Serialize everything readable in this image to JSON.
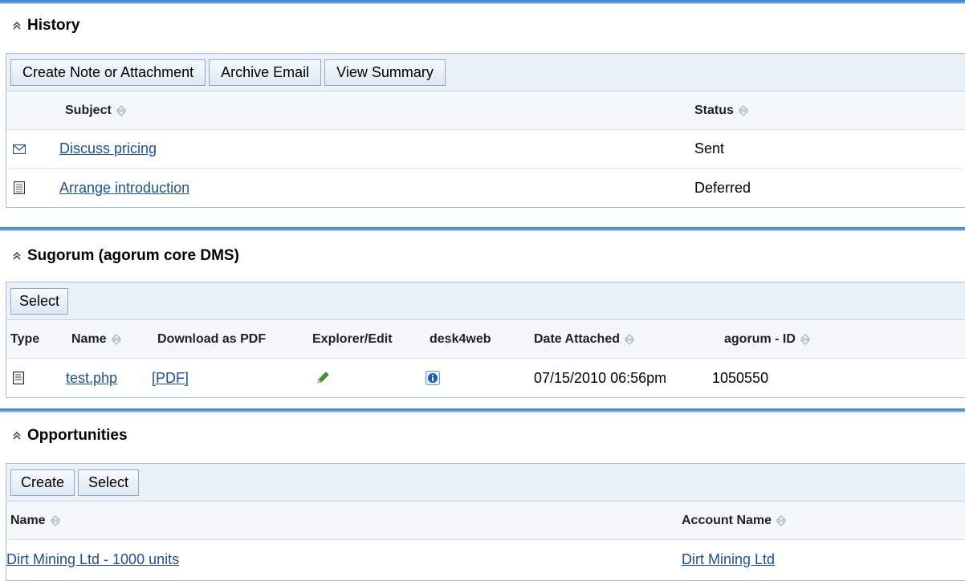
{
  "history": {
    "title": "History",
    "buttons": {
      "create_note": "Create Note or Attachment",
      "archive_email": "Archive Email",
      "view_summary": "View Summary"
    },
    "columns": {
      "subject": "Subject",
      "status": "Status"
    },
    "rows": [
      {
        "icon": "email-icon",
        "subject": "Discuss pricing",
        "status": "Sent"
      },
      {
        "icon": "note-icon",
        "subject": "Arrange introduction",
        "status": "Deferred"
      }
    ]
  },
  "sugorum": {
    "title": "Sugorum (agorum core DMS)",
    "buttons": {
      "select": "Select"
    },
    "columns": {
      "type": "Type",
      "name": "Name",
      "download_pdf": "Download as PDF",
      "explorer_edit": "Explorer/Edit",
      "desk4web": "desk4web",
      "date_attached": "Date Attached",
      "agorum_id": "agorum - ID"
    },
    "rows": [
      {
        "type_icon": "document-icon",
        "name": "test.php",
        "pdf_link": "[PDF]",
        "edit_icon": "pencil-icon",
        "desk4web_icon": "info-icon",
        "date_attached": "07/15/2010 06:56pm",
        "agorum_id": "1050550"
      }
    ]
  },
  "opportunities": {
    "title": "Opportunities",
    "buttons": {
      "create": "Create",
      "select": "Select"
    },
    "columns": {
      "name": "Name",
      "account_name": "Account Name"
    },
    "rows": [
      {
        "name": "Dirt Mining Ltd - 1000 units",
        "account_name": "Dirt Mining Ltd"
      }
    ]
  },
  "colors": {
    "section_bar": "#3f87cc",
    "toolbar_bg": "#eaf1f8",
    "link": "#1a4f9c",
    "pencil": "#3a9a2a",
    "info": "#1c5fc4"
  }
}
